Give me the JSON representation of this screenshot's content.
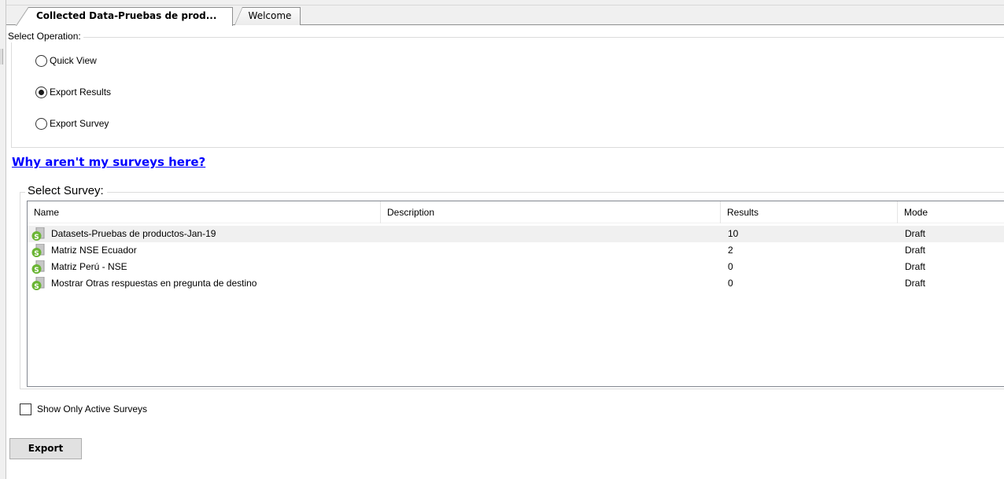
{
  "tabs": [
    {
      "label": "Collected Data-Pruebas de prod...",
      "active": true
    },
    {
      "label": "Welcome",
      "active": false
    }
  ],
  "operation": {
    "legend": "Select Operation:",
    "options": [
      {
        "label": "Quick View",
        "checked": false
      },
      {
        "label": "Export Results",
        "checked": true
      },
      {
        "label": "Export Survey",
        "checked": false
      }
    ]
  },
  "help_link": "Why aren't my surveys here?",
  "survey_select": {
    "legend": "Select Survey:",
    "columns": [
      "Name",
      "Description",
      "Results",
      "Mode"
    ],
    "rows": [
      {
        "icon": "survey-icon",
        "name": "Datasets-Pruebas de productos-Jan-19",
        "description": "",
        "results": "10",
        "mode": "Draft",
        "selected": true
      },
      {
        "icon": "survey-icon",
        "name": "Matriz NSE Ecuador",
        "description": "",
        "results": "2",
        "mode": "Draft",
        "selected": false
      },
      {
        "icon": "survey-icon",
        "name": "Matriz Perú - NSE",
        "description": "",
        "results": "0",
        "mode": "Draft",
        "selected": false
      },
      {
        "icon": "survey-icon",
        "name": "Mostrar Otras respuestas en pregunta de destino",
        "description": "",
        "results": "0",
        "mode": "Draft",
        "selected": false
      }
    ]
  },
  "show_only_active": {
    "label": "Show Only Active Surveys",
    "checked": false
  },
  "export_button": "Export",
  "colors": {
    "link": "#0000ff",
    "icon_green": "#6bb535",
    "selected_row": "#f0f0f0"
  }
}
